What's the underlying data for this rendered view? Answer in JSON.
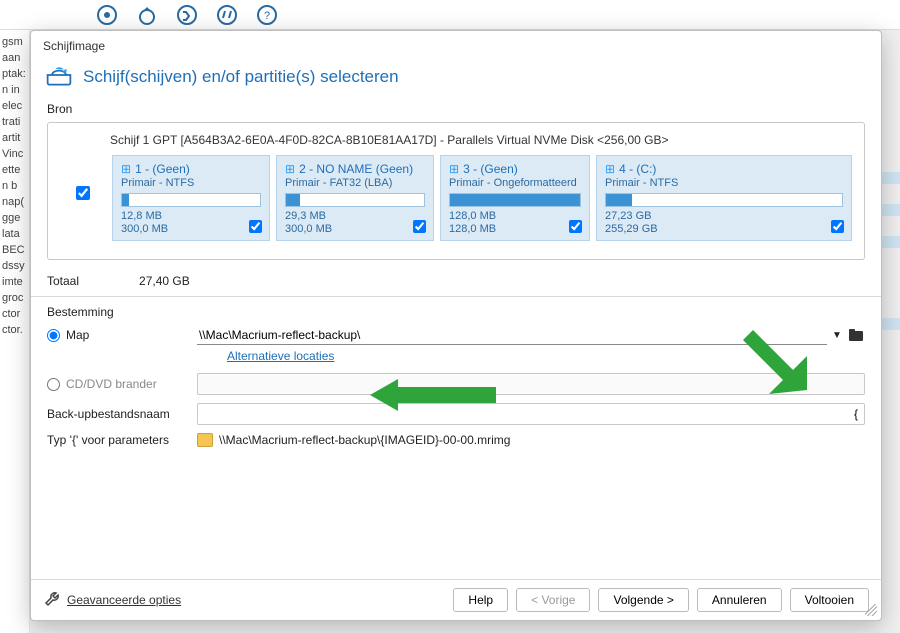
{
  "bg_left_frags": [
    "gsm",
    "aan",
    "ptak:",
    "n in",
    "elec",
    "trati",
    "artit",
    "Vinc",
    "ette",
    "n b",
    "nap(",
    "gge",
    "lata",
    "BEC",
    "dssy",
    "imte",
    "groc",
    "ctor",
    "ctor."
  ],
  "dialog": {
    "title": "Schijfimage",
    "heading": "Schijf(schijven) en/of partitie(s) selecteren",
    "source_label": "Bron",
    "disk_line": "Schijf 1 GPT [A564B3A2-6E0A-4F0D-82CA-8B10E81AA17D] - Parallels Virtual NVMe Disk  <256,00 GB>",
    "total_label": "Totaal",
    "total_value": "27,40 GB",
    "destination_label": "Bestemming",
    "radio_folder": "Map",
    "folder_path": "\\\\Mac\\Macrium-reflect-backup\\",
    "alt_locations": "Alternatieve locaties",
    "radio_cd": "CD/DVD brander",
    "backup_name_label": "Back-upbestandsnaam",
    "backup_name_value": "{",
    "param_hint_label": "Typ '{' voor parameters",
    "param_path": "\\\\Mac\\Macrium-reflect-backup\\{IMAGEID}-00-00.mrimg",
    "advanced": "Geavanceerde opties"
  },
  "partitions": [
    {
      "num": "1",
      "name": "(Geen)",
      "sub": "Primair - NTFS",
      "used": "12,8 MB",
      "total": "300,0 MB",
      "fill_pct": 5
    },
    {
      "num": "2",
      "name": "NO NAME (Geen)",
      "sub": "Primair - FAT32 (LBA)",
      "used": "29,3 MB",
      "total": "300,0 MB",
      "fill_pct": 10
    },
    {
      "num": "3",
      "name": "(Geen)",
      "sub": "Primair - Ongeformatteerd",
      "used": "128,0 MB",
      "total": "128,0 MB",
      "fill_pct": 100
    },
    {
      "num": "4",
      "name": "(C:)",
      "sub": "Primair - NTFS",
      "used": "27,23 GB",
      "total": "255,29 GB",
      "fill_pct": 11
    }
  ],
  "buttons": {
    "help": "Help",
    "prev": "< Vorige",
    "next": "Volgende >",
    "cancel": "Annuleren",
    "finish": "Voltooien"
  }
}
